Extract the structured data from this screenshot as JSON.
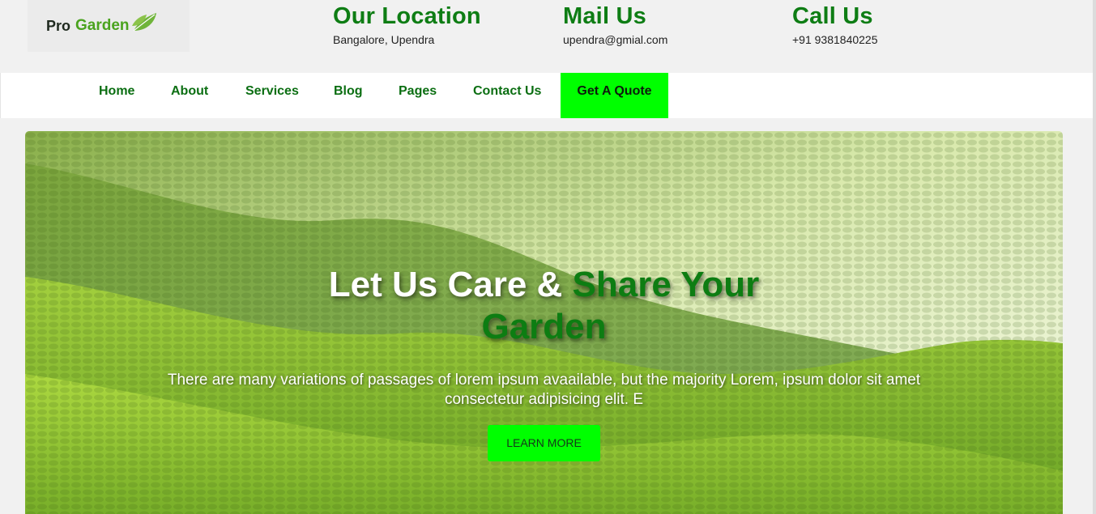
{
  "brand": {
    "pro": "Pro",
    "garden": "Garden",
    "logo_icon": "leaf-icon"
  },
  "contact": {
    "location": {
      "title": "Our Location",
      "value": "Bangalore, Upendra"
    },
    "mail": {
      "title": "Mail Us",
      "value": "upendra@gmial.com"
    },
    "call": {
      "title": "Call Us",
      "value": "+91 9381840225"
    }
  },
  "nav": {
    "items": [
      "Home",
      "About",
      "Services",
      "Blog",
      "Pages",
      "Contact Us"
    ],
    "quote": "Get A Quote"
  },
  "hero": {
    "title_white": "Let Us Care & ",
    "title_green_1": "Share Your",
    "title_green_2": "Garden",
    "text": "There are many variations of passages of lorem ipsum avaailable, but the majority Lorem, ipsum dolor sit amet consectetur adipisicing elit. E",
    "button": "LEARN MORE"
  },
  "colors": {
    "brand_green": "#0e7d14",
    "accent": "#00ff00",
    "logo_green": "#4aa31e"
  }
}
